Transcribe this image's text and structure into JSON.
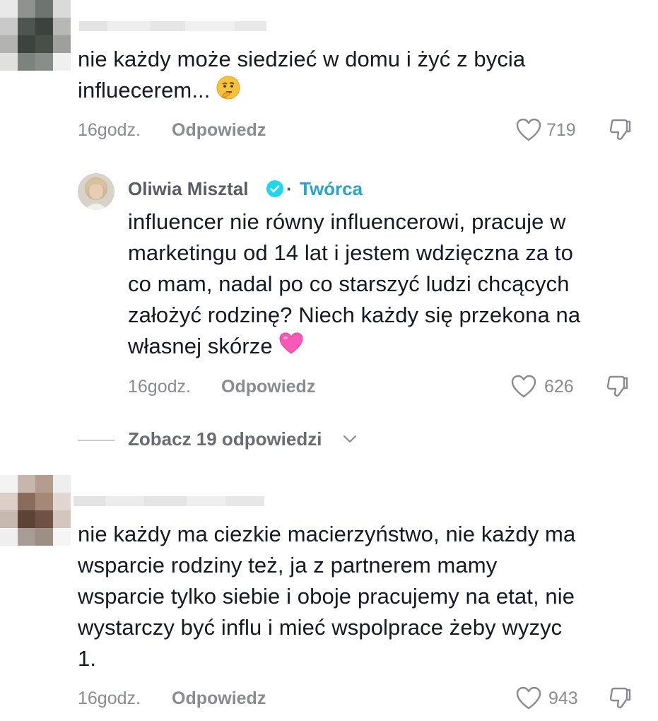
{
  "comments": [
    {
      "text_lines": [
        "nie każdy może siedzieć w domu i żyć z bycia",
        "influecerem..."
      ],
      "emoji": "thinking-face",
      "time": "16godz.",
      "reply_label": "Odpowiedz",
      "likes": "719"
    },
    {
      "author": "Oliwia Misztal",
      "author_badge": "·",
      "author_role": "Twórca",
      "text_lines": [
        "influencer nie równy influencerowi, pracuje w",
        "marketingu od 14 lat i jestem wdzięczna za to",
        "co mam, nadal po co starszyć ludzi chcących",
        "założyć rodzinę? Niech każdy się przekona na",
        "własnej skórze"
      ],
      "emoji": "pink-heart",
      "time": "16godz.",
      "reply_label": "Odpowiedz",
      "likes": "626"
    },
    {
      "text_lines": [
        "nie każdy ma ciezkie macierzyństwo, nie każdy ma",
        "wsparcie rodziny też, ja z partnerem mamy",
        "wsparcie tylko siebie i oboje pracujemy na etat, nie",
        "wystarczy być influ i mieć wspolprace żeby wyzyc",
        "1."
      ],
      "time": "16godz.",
      "reply_label": "Odpowiedz",
      "likes": "943"
    }
  ],
  "view_replies": "Zobacz 19 odpowiedzi",
  "colors": {
    "text": "#161823",
    "meta": "#8a8b91",
    "creator_accent": "#2aa3c4"
  }
}
